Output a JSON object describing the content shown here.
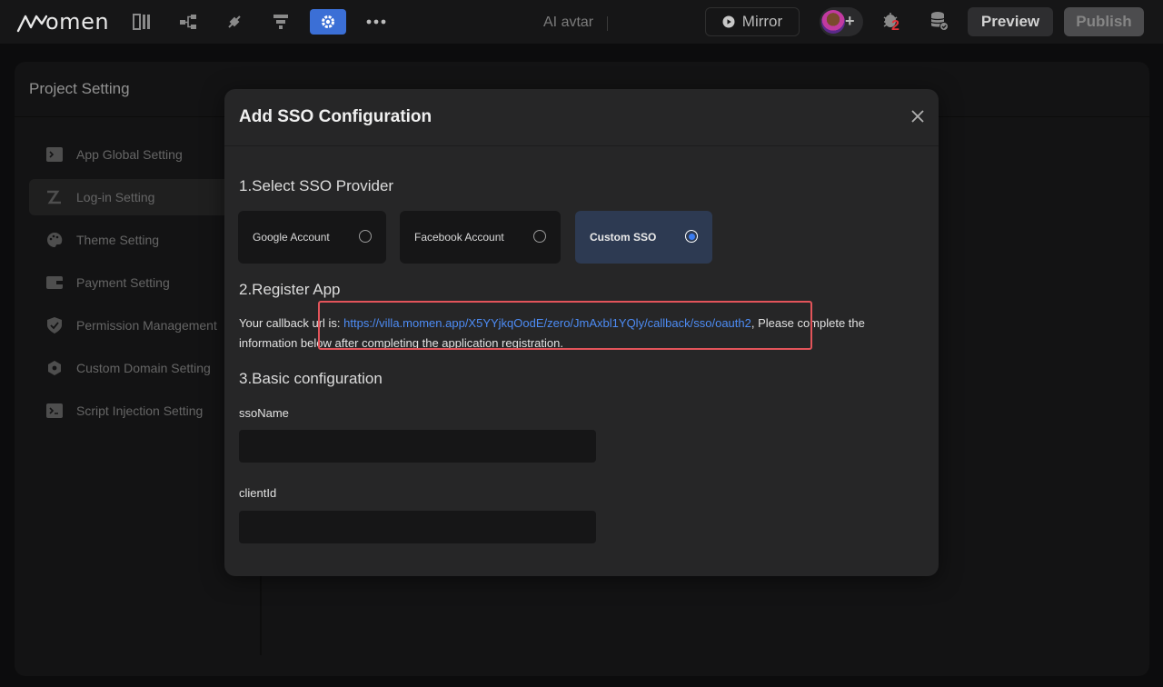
{
  "topbar": {
    "logo_text": "omen",
    "app_title": "AI avtar",
    "mirror_label": "Mirror",
    "bug_count": "2",
    "preview_label": "Preview",
    "publish_label": "Publish",
    "icons": [
      "layout-icon",
      "flow-icon",
      "plugin-icon",
      "component-icon",
      "settings-icon",
      "more-icon"
    ]
  },
  "project": {
    "title": "Project Setting",
    "menu": [
      {
        "label": "App Global Setting",
        "icon": "terminal-icon",
        "active": false
      },
      {
        "label": "Log-in Setting",
        "icon": "login-icon",
        "active": true
      },
      {
        "label": "Theme Setting",
        "icon": "palette-icon",
        "active": false
      },
      {
        "label": "Payment Setting",
        "icon": "wallet-icon",
        "active": false
      },
      {
        "label": "Permission Management",
        "icon": "shield-icon",
        "active": false
      },
      {
        "label": "Custom Domain Setting",
        "icon": "domain-icon",
        "active": false
      },
      {
        "label": "Script Injection Setting",
        "icon": "script-icon",
        "active": false
      }
    ]
  },
  "modal": {
    "title": "Add SSO Configuration",
    "step1": "1.Select SSO Provider",
    "providers": [
      {
        "label": "Google Account",
        "selected": false
      },
      {
        "label": "Facebook Account",
        "selected": false
      },
      {
        "label": "Custom SSO",
        "selected": true
      }
    ],
    "step2": "2.Register App",
    "callback_prefix": "Your callback url is: ",
    "callback_url": "https://villa.momen.app/X5YYjkqOodE/zero/JmAxbl1YQly/callback/sso/oauth2",
    "callback_suffix": ", Please complete the information below after completing the application registration.",
    "step3": "3.Basic configuration",
    "fields": [
      {
        "label": "ssoName",
        "value": ""
      },
      {
        "label": "clientId",
        "value": ""
      }
    ]
  },
  "colors": {
    "accent": "#3b6fd6",
    "link": "#4d8cf5",
    "highlight": "#e2545a",
    "selected_provider_bg": "#2d3a52"
  }
}
